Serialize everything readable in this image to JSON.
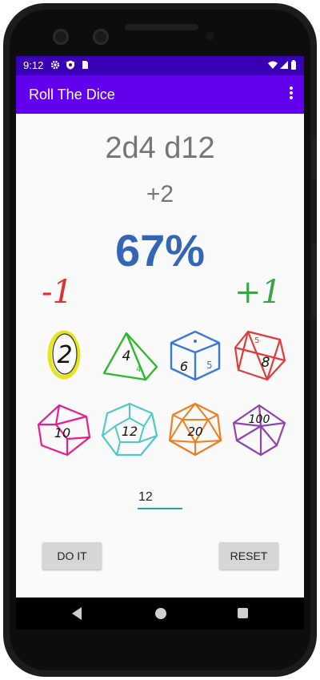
{
  "status_bar": {
    "time": "9:12",
    "icons": [
      "settings-icon",
      "shield-icon",
      "sim-card-icon",
      "wifi-icon",
      "signal-icon",
      "battery-icon"
    ]
  },
  "app_bar": {
    "title": "Roll The Dice",
    "menu_icon": "more-vert-icon",
    "color": "#6200ee",
    "status_color": "#3700b3"
  },
  "main": {
    "dice_expression": "2d4 d12",
    "modifier": "+2",
    "probability": "67%",
    "minus_label": "-1",
    "plus_label": "+1"
  },
  "dice": [
    {
      "label": "2",
      "type": "d2",
      "color": "#e6e61e"
    },
    {
      "label": "4",
      "type": "d4",
      "color": "#2eb82e"
    },
    {
      "label": "6",
      "type": "d6",
      "color": "#3a78d8"
    },
    {
      "label": "8",
      "type": "d8",
      "color": "#e03a3a"
    },
    {
      "label": "10",
      "type": "d10",
      "color": "#e61e8c"
    },
    {
      "label": "12",
      "type": "d12",
      "color": "#4ec8c8"
    },
    {
      "label": "20",
      "type": "d20",
      "color": "#f07d1e"
    },
    {
      "label": "100",
      "type": "d100",
      "color": "#8e44ad"
    }
  ],
  "input": {
    "value": "12"
  },
  "buttons": {
    "do_it": "DO IT",
    "reset": "RESET"
  },
  "nav_bar": {
    "icons": [
      "back-icon",
      "home-icon",
      "recents-icon"
    ]
  }
}
